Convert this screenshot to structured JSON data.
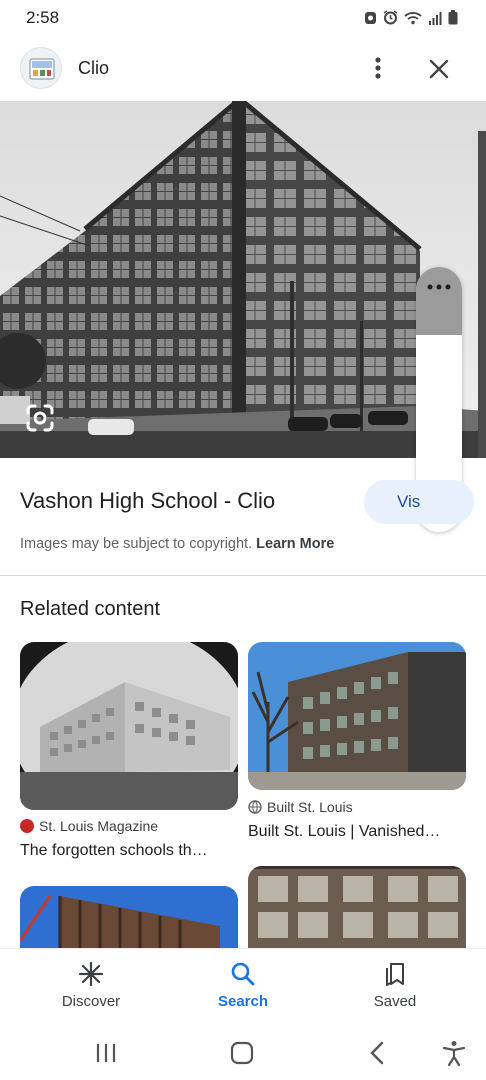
{
  "status": {
    "time": "2:58"
  },
  "header": {
    "site_name": "Clio"
  },
  "result": {
    "title": "Vashon High School - Clio",
    "visit_label": "Vis",
    "copyright_text": "Images may be subject to copyright.",
    "learn_more": "Learn More"
  },
  "related": {
    "heading": "Related content",
    "cards": [
      {
        "source": "St. Louis Magazine",
        "title": "The forgotten schools th…"
      },
      {
        "source": "Built St. Louis",
        "title": "Built St. Louis | Vanished…"
      },
      {
        "source": "",
        "title": ""
      },
      {
        "source": "",
        "title": ""
      }
    ]
  },
  "bottom_nav": [
    {
      "label": "Discover",
      "icon": "asterisk-icon"
    },
    {
      "label": "Search",
      "icon": "search-icon",
      "active": true
    },
    {
      "label": "Saved",
      "icon": "saved-icon"
    }
  ],
  "colors": {
    "accent": "#1a73e8",
    "visit_bg": "#e8f0fe",
    "visit_text": "#1a4fa0"
  }
}
